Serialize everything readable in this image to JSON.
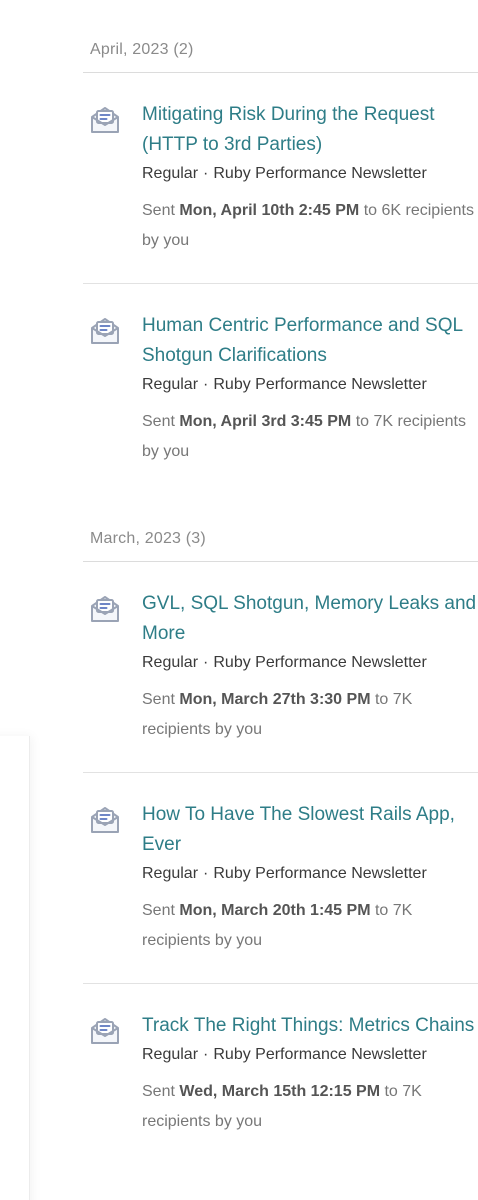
{
  "groups": [
    {
      "header": "April, 2023 (2)",
      "items": [
        {
          "title": "Mitigating Risk During the Request (HTTP to 3rd Parties)",
          "type": "Regular",
          "newsletter": "Ruby Performance Newsletter",
          "sent_prefix": "Sent",
          "sent_date": "Mon, April 10th 2:45 PM",
          "sent_suffix": "to 6K recipients by you"
        },
        {
          "title": "Human Centric Performance and SQL Shotgun Clarifications",
          "type": "Regular",
          "newsletter": "Ruby Performance Newsletter",
          "sent_prefix": "Sent",
          "sent_date": "Mon, April 3rd 3:45 PM",
          "sent_suffix": "to 7K recipients by you"
        }
      ]
    },
    {
      "header": "March, 2023 (3)",
      "items": [
        {
          "title": "GVL, SQL Shotgun, Memory Leaks and More",
          "type": "Regular",
          "newsletter": "Ruby Performance Newsletter",
          "sent_prefix": "Sent",
          "sent_date": "Mon, March 27th 3:30 PM",
          "sent_suffix": "to 7K recipients by you"
        },
        {
          "title": "How To Have The Slowest Rails App, Ever",
          "type": "Regular",
          "newsletter": "Ruby Performance Newsletter",
          "sent_prefix": "Sent",
          "sent_date": "Mon, March 20th 1:45 PM",
          "sent_suffix": "to 7K recipients by you"
        },
        {
          "title": "Track The Right Things: Metrics Chains",
          "type": "Regular",
          "newsletter": "Ruby Performance Newsletter",
          "sent_prefix": "Sent",
          "sent_date": "Wed, March 15th 12:15 PM",
          "sent_suffix": "to 7K recipients by you"
        }
      ]
    }
  ],
  "meta_separator": "·",
  "icon": "envelope-open-icon",
  "colors": {
    "title_link": "#2e7d87",
    "icon_stroke": "#9aa3b5",
    "icon_accent": "#6f86c6"
  }
}
